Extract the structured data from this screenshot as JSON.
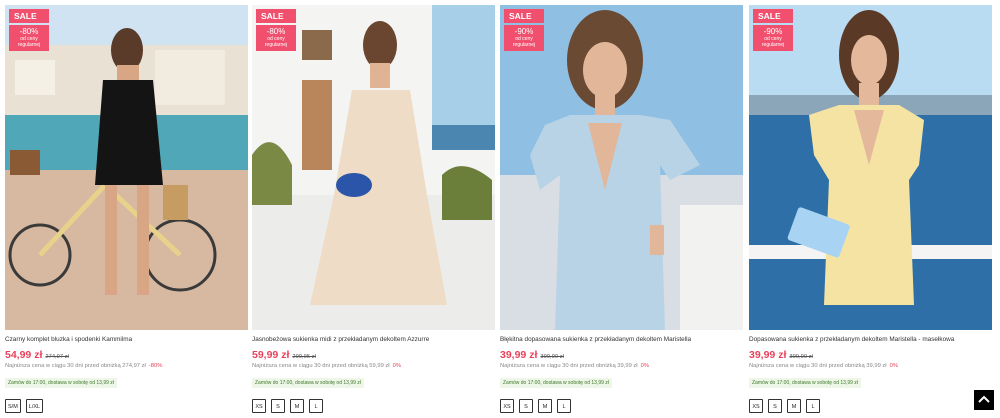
{
  "products": [
    {
      "sale_label": "SALE",
      "discount": "-80%",
      "discount_note": "od ceny regularnej",
      "name": "Czarny komplet bluzka i spodenki Kammilma",
      "price": "54,99 zł",
      "old_price": "274,97 zł",
      "lowest_text": "Najniższa cena w ciągu 30 dni przed obniżką 274,97 zł",
      "lowest_pct": "-80%",
      "delivery": "Zamów do 17:00, dostawa w sobotę od 13,99 zł",
      "sizes": [
        "S/M",
        "L/XL"
      ],
      "outfit_color": "#141414"
    },
    {
      "sale_label": "SALE",
      "discount": "-80%",
      "discount_note": "od ceny regularnej",
      "name": "Jasnobeżowa sukienka midi z przekładanym dekoltem Azzurre",
      "price": "59,99 zł",
      "old_price": "299,95 zł",
      "lowest_text": "Najniższa cena w ciągu 30 dni przed obniżką 59,99 zł",
      "lowest_pct": "0%",
      "delivery": "Zamów do 17:00, dostawa w sobotę od 13,99 zł",
      "sizes": [
        "XS",
        "S",
        "M",
        "L"
      ],
      "outfit_color": "#efdcc6"
    },
    {
      "sale_label": "SALE",
      "discount": "-90%",
      "discount_note": "od ceny regularnej",
      "name": "Błękitna dopasowana sukienka z przekładanym dekoltem Maristella",
      "price": "39,99 zł",
      "old_price": "399,90 zł",
      "lowest_text": "Najniższa cena w ciągu 30 dni przed obniżką 39,99 zł",
      "lowest_pct": "0%",
      "delivery": "Zamów do 17:00, dostawa w sobotę od 13,99 zł",
      "sizes": [
        "XS",
        "S",
        "M",
        "L"
      ],
      "outfit_color": "#b9d3e6"
    },
    {
      "sale_label": "SALE",
      "discount": "-90%",
      "discount_note": "od ceny regularnej",
      "name": "Dopasowana sukienka z przekładanym dekoltem Maristella - masełkowa",
      "price": "39,99 zł",
      "old_price": "399,90 zł",
      "lowest_text": "Najniższa cena w ciągu 30 dni przed obniżką 39,99 zł",
      "lowest_pct": "0%",
      "delivery": "Zamów do 17:00, dostawa w sobotę od 13,99 zł",
      "sizes": [
        "XS",
        "S",
        "M",
        "L"
      ],
      "outfit_color": "#f4e3a3"
    }
  ],
  "scroll_top_icon": "chevron-up-icon",
  "colors": {
    "sale": "#f0506e",
    "price": "#e8425b",
    "delivery_text": "#3d7a2a"
  }
}
